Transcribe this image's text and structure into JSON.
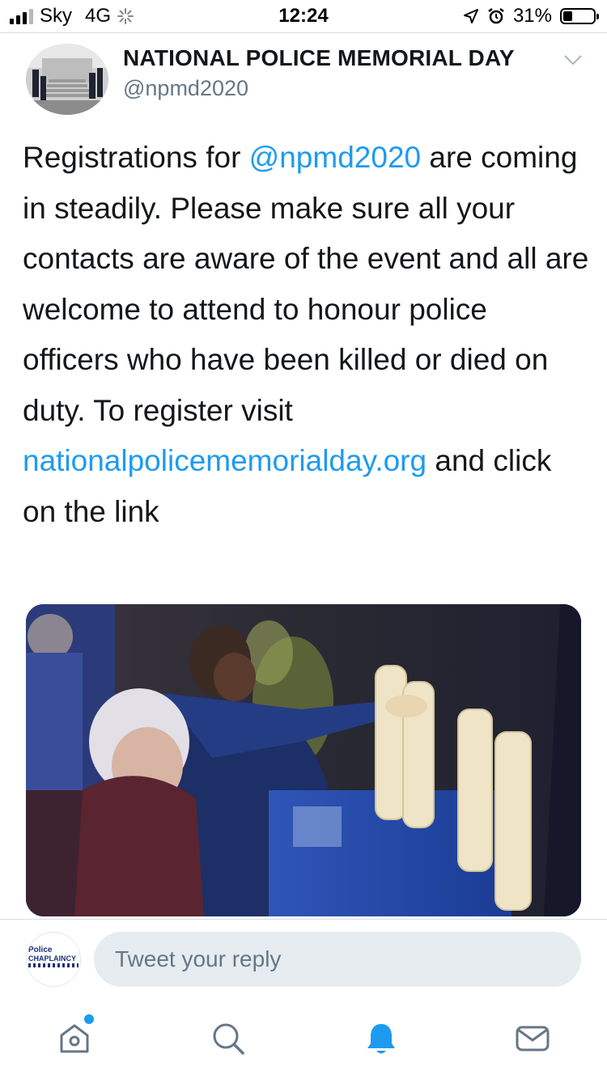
{
  "status_bar": {
    "carrier": "Sky",
    "network": "4G",
    "time": "12:24",
    "battery_percent": "31%",
    "battery_level": 0.31,
    "icons": [
      "signal-icon",
      "activity-spinner-icon",
      "location-arrow-icon",
      "alarm-icon",
      "battery-icon"
    ]
  },
  "tweet": {
    "display_name": "NATIONAL POLICE MEMORIAL DAY",
    "handle": "@npmd2020",
    "text_1": "Registrations for ",
    "mention": "@npmd2020",
    "text_2": " are coming in steadily.  Please make sure all your contacts are aware of the event and all are welcome to attend to honour police officers who have been killed or died on duty.  To register visit ",
    "link": "nationalpolicememorialday.org",
    "text_3": " and click on the link"
  },
  "reply": {
    "avatar_text_line1": "Police",
    "avatar_text_line2": "CHAPLAINCY",
    "placeholder": "Tweet your reply"
  },
  "tab_bar": {
    "items": [
      "home-icon",
      "search-icon",
      "notifications-icon",
      "messages-icon"
    ],
    "active": "notifications-icon",
    "home_has_badge": true
  },
  "colors": {
    "accent": "#1d9bf0",
    "text": "#14171a",
    "secondary": "#657786",
    "input_bg": "#e6ecf0"
  }
}
